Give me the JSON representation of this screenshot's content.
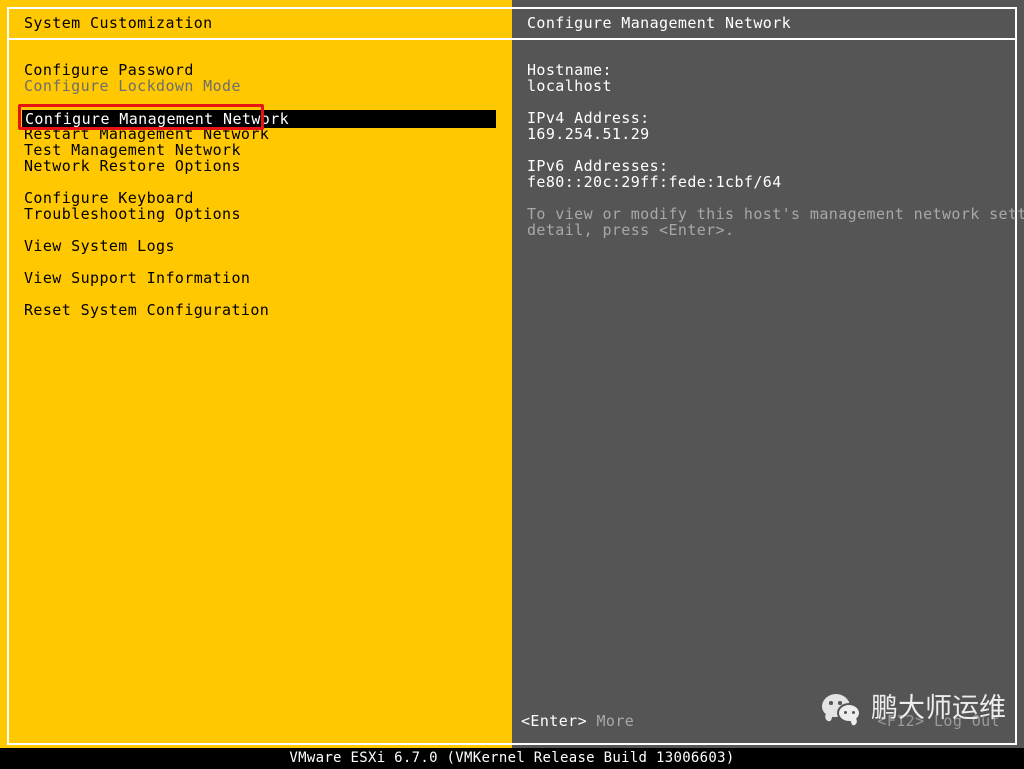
{
  "colors": {
    "left_pane_bg": "#ffc800",
    "right_pane_bg": "#555555",
    "selection_bg": "#000000",
    "selection_fg": "#ffffff",
    "annotation_red": "#e81313",
    "dim_text": "#6e6e6e",
    "status_bar_bg": "#000000"
  },
  "left_pane": {
    "title": "System Customization",
    "menu": [
      {
        "label": "Configure Password",
        "state": "normal"
      },
      {
        "label": "Configure Lockdown Mode",
        "state": "dim"
      },
      {
        "label": "",
        "state": "spacer"
      },
      {
        "label": "Configure Management Network",
        "state": "selected"
      },
      {
        "label": "Restart Management Network",
        "state": "normal"
      },
      {
        "label": "Test Management Network",
        "state": "normal"
      },
      {
        "label": "Network Restore Options",
        "state": "normal"
      },
      {
        "label": "",
        "state": "spacer"
      },
      {
        "label": "Configure Keyboard",
        "state": "normal"
      },
      {
        "label": "Troubleshooting Options",
        "state": "normal"
      },
      {
        "label": "",
        "state": "spacer"
      },
      {
        "label": "View System Logs",
        "state": "normal"
      },
      {
        "label": "",
        "state": "spacer"
      },
      {
        "label": "View Support Information",
        "state": "normal"
      },
      {
        "label": "",
        "state": "spacer"
      },
      {
        "label": "Reset System Configuration",
        "state": "normal"
      }
    ]
  },
  "right_pane": {
    "title": "Configure Management Network",
    "details": [
      {
        "text": "Hostname:",
        "style": "normal"
      },
      {
        "text": "localhost",
        "style": "normal"
      },
      {
        "text": "",
        "style": "gap"
      },
      {
        "text": "IPv4 Address:",
        "style": "normal"
      },
      {
        "text": "169.254.51.29",
        "style": "normal"
      },
      {
        "text": "",
        "style": "gap"
      },
      {
        "text": "IPv6 Addresses:",
        "style": "normal"
      },
      {
        "text": "fe80::20c:29ff:fede:1cbf/64",
        "style": "normal"
      },
      {
        "text": "",
        "style": "gap"
      },
      {
        "text": "To view or modify this host's management network settings in",
        "style": "muted"
      },
      {
        "text": "detail, press <Enter>.",
        "style": "muted"
      }
    ],
    "hints": {
      "enter_key": "<Enter>",
      "enter_action": "More",
      "logout_key": "<F12>",
      "logout_action": "Log Out"
    }
  },
  "watermark": {
    "icon": "wechat-icon",
    "text": "鹏大师运维"
  },
  "status_bar": {
    "text": "VMware ESXi 6.7.0 (VMKernel Release Build 13006603)"
  }
}
